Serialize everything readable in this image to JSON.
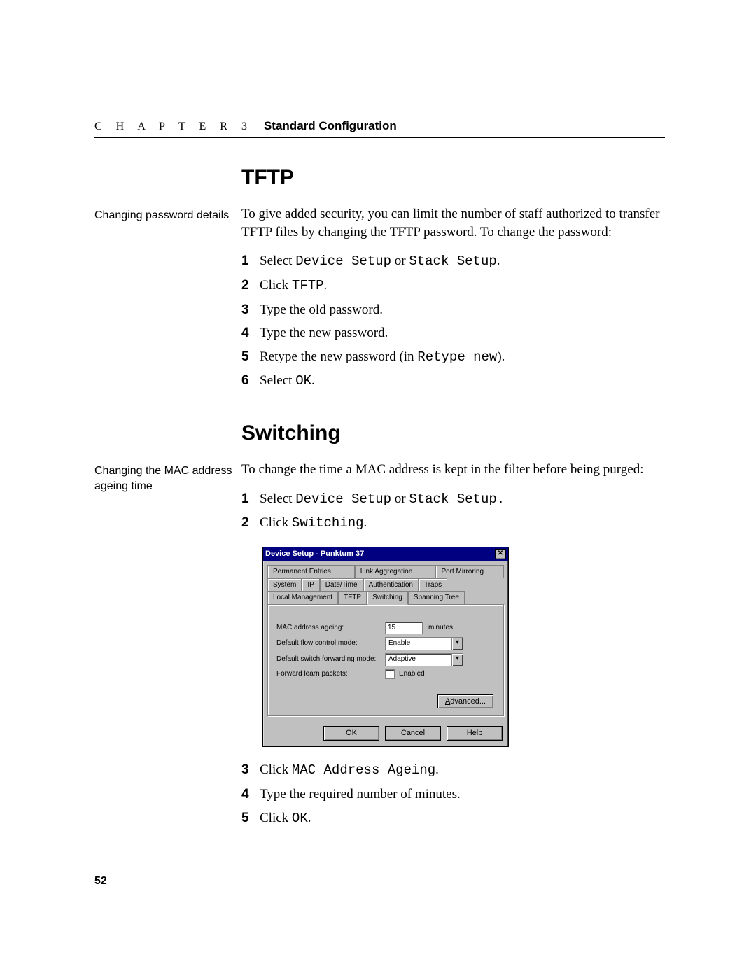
{
  "header": {
    "chapter_label": "C H A P T E R 3",
    "chapter_title": "Standard Configuration"
  },
  "section1": {
    "heading": "TFTP",
    "sidenote": "Changing password details",
    "intro": "To give added security, you can limit the number of staff authorized to transfer TFTP files by changing the TFTP password. To change the password:",
    "steps": [
      {
        "pre": "Select ",
        "code": "Device Setup",
        "mid": " or ",
        "code2": "Stack Setup",
        "post": "."
      },
      {
        "pre": "Click ",
        "code": "TFTP",
        "post": "."
      },
      {
        "pre": "Type the old password."
      },
      {
        "pre": "Type the new password."
      },
      {
        "pre": "Retype the new password (in ",
        "code": "Retype new",
        "post": ")."
      },
      {
        "pre": "Select ",
        "code": "OK",
        "post": "."
      }
    ]
  },
  "section2": {
    "heading": "Switching",
    "sidenote": "Changing the MAC address ageing time",
    "intro": "To change the time a MAC address is kept in the filter before being purged:",
    "steps_a": [
      {
        "pre": "Select ",
        "code": "Device Setup",
        "mid": " or ",
        "code2": "Stack Setup.",
        "post": ""
      },
      {
        "pre": "Click ",
        "code": "Switching",
        "post": "."
      }
    ],
    "steps_b": [
      {
        "pre": "Click ",
        "code": "MAC Address Ageing",
        "post": "."
      },
      {
        "pre": "Type the required number of minutes."
      },
      {
        "pre": "Click ",
        "code": "OK",
        "post": "."
      }
    ]
  },
  "dialog": {
    "title": "Device Setup - Punktum 37",
    "close": "✕",
    "tabs_row1": [
      "Permanent Entries",
      "Link Aggregation",
      "Port Mirroring"
    ],
    "tabs_row2": [
      "System",
      "IP",
      "Date/Time",
      "Authentication",
      "Traps"
    ],
    "tabs_row3": [
      "Local Management",
      "TFTP",
      "Switching",
      "Spanning Tree"
    ],
    "active_tab": "Switching",
    "fields": {
      "mac_label": "MAC address ageing:",
      "mac_value": "15",
      "mac_unit": "minutes",
      "flow_label": "Default flow control mode:",
      "flow_value": "Enable",
      "fwd_label": "Default switch forwarding mode:",
      "fwd_value": "Adaptive",
      "learn_label": "Forward learn packets:",
      "learn_chk_label": "Enabled"
    },
    "buttons": {
      "advanced": "Advanced...",
      "ok": "OK",
      "cancel": "Cancel",
      "help": "Help"
    }
  },
  "page_number": "52"
}
